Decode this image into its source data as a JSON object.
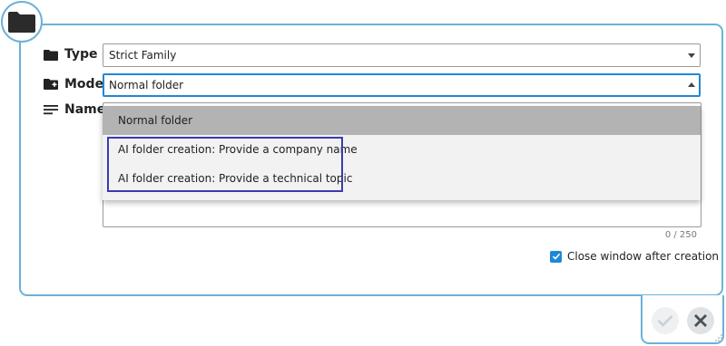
{
  "form": {
    "type_label": "Type",
    "type_value": "Strict Family",
    "mode_label": "Mode",
    "mode_value": "Normal folder",
    "name_label": "Name",
    "char_counter": "0 / 250"
  },
  "mode_dropdown": {
    "options": [
      "Normal folder",
      "AI folder creation: Provide a company name",
      "AI folder creation: Provide a technical topic"
    ],
    "selected_index": 0
  },
  "close_after_creation": {
    "label": "Close window after creation",
    "checked": true
  },
  "icons": {
    "header": "folder-icon",
    "type": "folder-icon",
    "mode": "folder-plus-icon",
    "name": "text-lines-icon",
    "confirm": "checkmark-icon",
    "close": "close-icon"
  },
  "colors": {
    "border_accent": "#6ab2d8",
    "focus_blue": "#1e88d8",
    "highlight_outline": "#3a3ab0",
    "selected_option": "#b3b3b3"
  }
}
